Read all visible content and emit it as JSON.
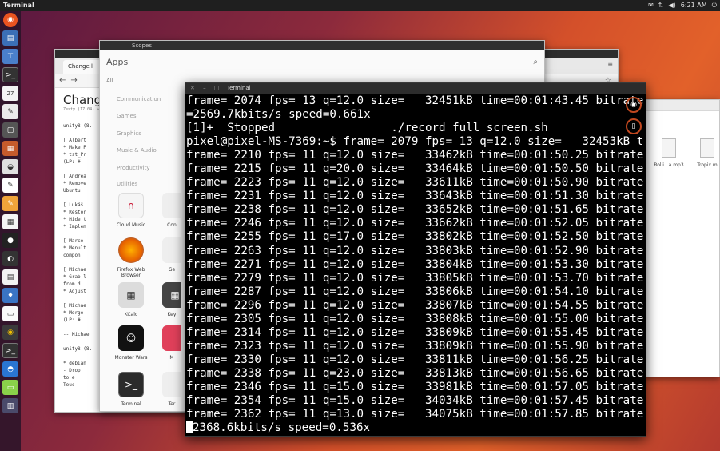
{
  "top_panel": {
    "title": "Terminal",
    "clock": "6:21 AM",
    "icons": [
      "mail-icon",
      "network-icon",
      "volume-icon",
      "power-icon"
    ]
  },
  "launcher": {
    "icons": [
      "ubuntu-logo-icon",
      "files-icon",
      "network-icon",
      "terminal-icon",
      "calendar-icon",
      "text-editor-icon",
      "window-icon",
      "files-icon",
      "browser-icon",
      "writer-icon",
      "impress-icon",
      "calc-icon",
      "bomb-icon",
      "software-icon",
      "calculator-icon",
      "tips-icon",
      "terminal-icon",
      "firefox-icon",
      "camera-icon",
      "app-icon",
      "trash-icon"
    ]
  },
  "browser": {
    "tab_label": "Change l",
    "heading": "Chang",
    "meta": "Zesty (17.04) » Chr",
    "lines": [
      "unity8 (8.",
      "",
      "  [ Albert",
      "  * Make P",
      "  * tst_Pr",
      "    (LP: #",
      "",
      "  [ Andrea",
      "  * Remove",
      "    Ubuntu",
      "",
      "  [ Lukáš",
      "  * Restor",
      "  * Hide t",
      "  * Implem",
      "",
      "  [ Marco",
      "  * Menult",
      "    compon",
      "",
      "  [ Michae",
      "  * Grab l",
      "    from d",
      "  * Adjust",
      "",
      "  [ Michae",
      "  * Merge",
      "    (LP: #",
      "",
      " -- Michae",
      "",
      "unity8 (8.",
      "",
      "  * debian",
      "    - Drop",
      "      to e",
      "      Touc"
    ]
  },
  "files": {
    "items": [
      "Rolli...a.mp3",
      "Tropix.m"
    ]
  },
  "scopes": {
    "window_title": "Scopes",
    "title": "Apps",
    "all_label": "All",
    "categories": [
      "Communication",
      "Games",
      "Graphics",
      "Music & Audio",
      "Productivity",
      "Utilities"
    ],
    "apps": [
      {
        "label": "Cloud Music",
        "icon": "music-icon"
      },
      {
        "label": "Con",
        "icon": "app-icon"
      },
      {
        "label": "Firefox Web Browser",
        "icon": "firefox-icon"
      },
      {
        "label": "Ge",
        "icon": "app-icon"
      },
      {
        "label": "KCalc",
        "icon": "calculator-icon"
      },
      {
        "label": "Key",
        "icon": "keyboard-icon"
      },
      {
        "label": "Monster Wars",
        "icon": "game-icon"
      },
      {
        "label": "M",
        "icon": "app-icon"
      },
      {
        "label": "Terminal",
        "icon": "terminal-icon"
      },
      {
        "label": "Ter",
        "icon": "app-icon"
      }
    ]
  },
  "terminal": {
    "window_title": "Terminal",
    "lines": [
      "frame= 2074 fps= 13 q=12.0 size=   32451kB time=00:01:43.45 bitrate",
      "=2569.7kbits/s speed=0.661x",
      "[1]+  Stopped                 ./record_full_screen.sh",
      "pixel@pixel-MS-7369:~$ frame= 2079 fps= 13 q=12.0 size=   32453kB t",
      "frame= 2210 fps= 11 q=12.0 size=   33462kB time=00:01:50.25 bitrate",
      "frame= 2215 fps= 11 q=20.0 size=   33464kB time=00:01:50.50 bitrate",
      "frame= 2223 fps= 11 q=12.0 size=   33611kB time=00:01:50.90 bitrate",
      "frame= 2231 fps= 11 q=12.0 size=   33643kB time=00:01:51.30 bitrate",
      "frame= 2238 fps= 11 q=12.0 size=   33652kB time=00:01:51.65 bitrate",
      "frame= 2246 fps= 11 q=12.0 size=   33662kB time=00:01:52.05 bitrate",
      "frame= 2255 fps= 11 q=17.0 size=   33802kB time=00:01:52.50 bitrate",
      "frame= 2263 fps= 11 q=12.0 size=   33803kB time=00:01:52.90 bitrate",
      "frame= 2271 fps= 11 q=12.0 size=   33804kB time=00:01:53.30 bitrate",
      "frame= 2279 fps= 11 q=12.0 size=   33805kB time=00:01:53.70 bitrate",
      "frame= 2287 fps= 11 q=12.0 size=   33806kB time=00:01:54.10 bitrate",
      "frame= 2296 fps= 11 q=12.0 size=   33807kB time=00:01:54.55 bitrate",
      "frame= 2305 fps= 11 q=12.0 size=   33808kB time=00:01:55.00 bitrate",
      "frame= 2314 fps= 11 q=12.0 size=   33809kB time=00:01:55.45 bitrate",
      "frame= 2323 fps= 11 q=12.0 size=   33809kB time=00:01:55.90 bitrate",
      "frame= 2330 fps= 11 q=12.0 size=   33811kB time=00:01:56.25 bitrate",
      "frame= 2338 fps= 11 q=23.0 size=   33813kB time=00:01:56.65 bitrate",
      "frame= 2346 fps= 11 q=15.0 size=   33981kB time=00:01:57.05 bitrate",
      "frame= 2354 fps= 11 q=15.0 size=   34034kB time=00:01:57.45 bitrate",
      "frame= 2362 fps= 11 q=13.0 size=   34075kB time=00:01:57.85 bitrate"
    ],
    "last_line": "2368.6kbits/s speed=0.536x"
  }
}
